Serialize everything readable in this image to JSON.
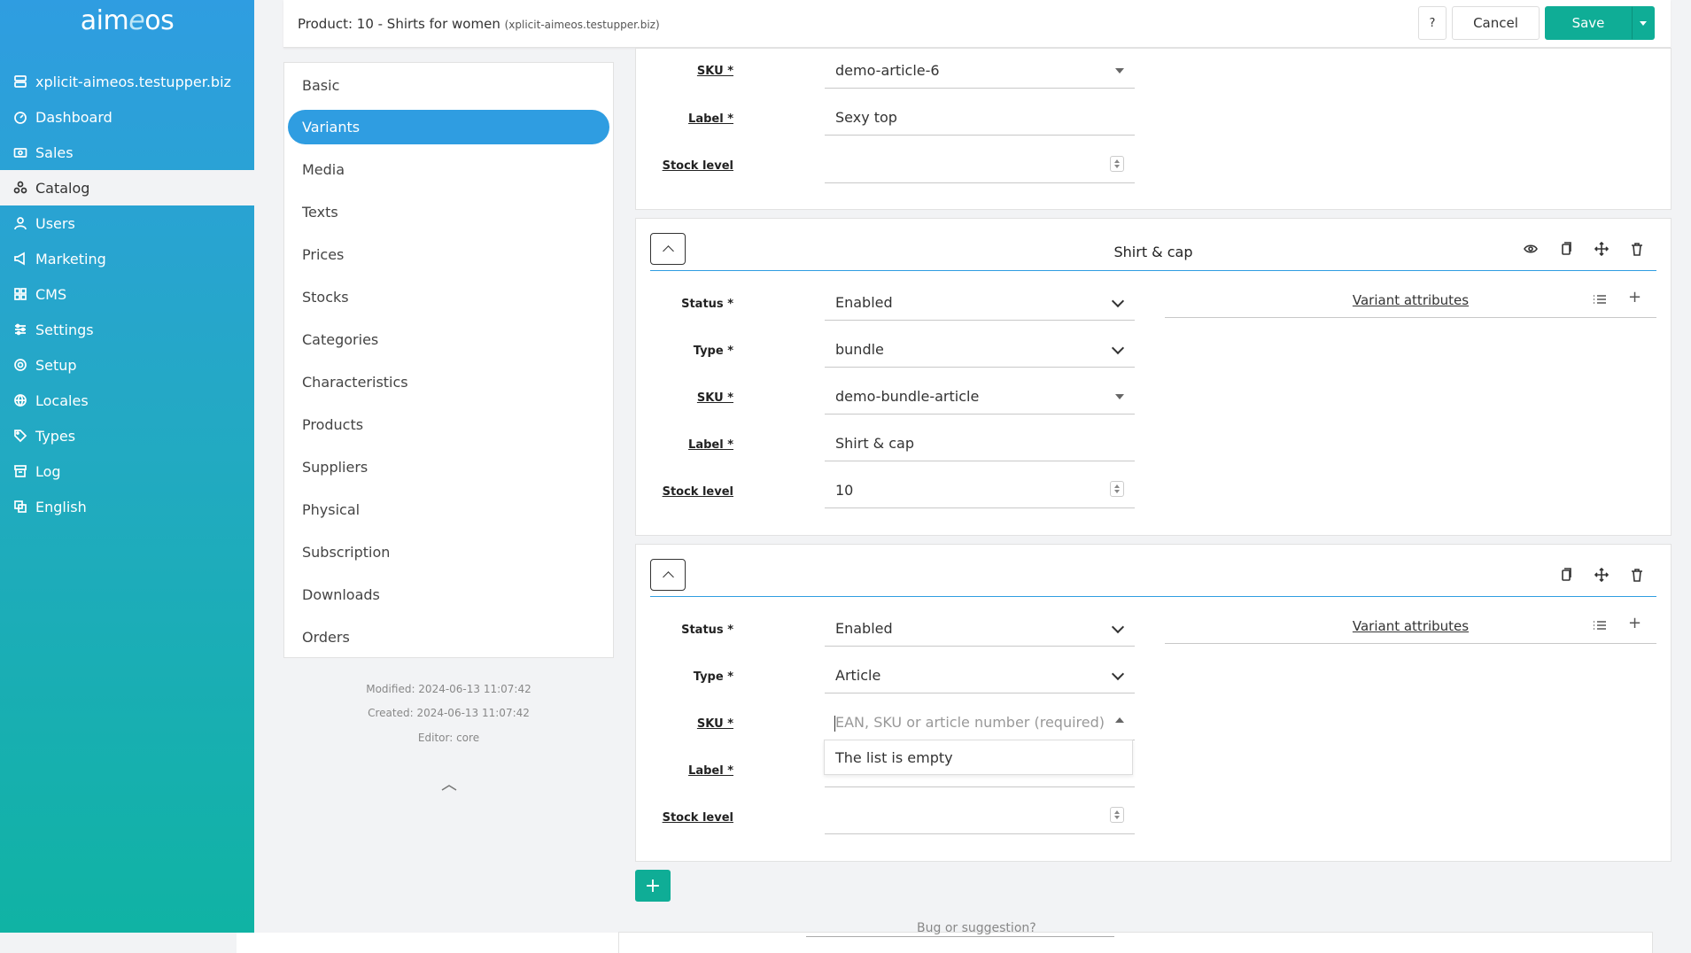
{
  "brand": {
    "logo_pre": "aim",
    "logo_e": "e",
    "logo_post": "os"
  },
  "nav": [
    {
      "label": "xplicit-aimeos.testupper.biz",
      "icon": "server-icon"
    },
    {
      "label": "Dashboard",
      "icon": "dashboard-icon"
    },
    {
      "label": "Sales",
      "icon": "cash-icon"
    },
    {
      "label": "Catalog",
      "icon": "catalog-icon"
    },
    {
      "label": "Users",
      "icon": "user-icon"
    },
    {
      "label": "Marketing",
      "icon": "megaphone-icon"
    },
    {
      "label": "CMS",
      "icon": "grid-icon"
    },
    {
      "label": "Settings",
      "icon": "sliders-icon"
    },
    {
      "label": "Setup",
      "icon": "gear-icon"
    },
    {
      "label": "Locales",
      "icon": "globe-icon"
    },
    {
      "label": "Types",
      "icon": "tags-icon"
    },
    {
      "label": "Log",
      "icon": "archive-icon"
    },
    {
      "label": "English",
      "icon": "translate-icon"
    }
  ],
  "header": {
    "title": "Product: 10 - Shirts for women",
    "site": "(xplicit-aimeos.testupper.biz)",
    "help": "?",
    "cancel": "Cancel",
    "save": "Save"
  },
  "tabs": [
    "Basic",
    "Variants",
    "Media",
    "Texts",
    "Prices",
    "Stocks",
    "Categories",
    "Characteristics",
    "Products",
    "Suppliers",
    "Physical",
    "Subscription",
    "Downloads",
    "Orders"
  ],
  "meta": {
    "modified": "Modified: 2024-06-13 11:07:42",
    "created": "Created: 2024-06-13 11:07:42",
    "editor": "Editor: core"
  },
  "labels": {
    "status": "Status *",
    "type": "Type *",
    "sku": "SKU *",
    "label": "Label *",
    "stock": "Stock level",
    "variant_attributes": "Variant attributes"
  },
  "variant1": {
    "sku": "demo-article-6",
    "label": "Sexy top",
    "stock": ""
  },
  "variant2": {
    "title": "Shirt & cap",
    "status": "Enabled",
    "type": "bundle",
    "sku": "demo-bundle-article",
    "label": "Shirt & cap",
    "stock": "10"
  },
  "variant3": {
    "title": "",
    "status": "Enabled",
    "type": "Article",
    "sku_placeholder": "EAN, SKU or article number (required)",
    "dropdown_text": "The list is empty",
    "stock": ""
  },
  "footer": {
    "text": "Bug or suggestion?"
  },
  "colors": {
    "accent": "#2f9de1",
    "primary": "#0fad96"
  }
}
